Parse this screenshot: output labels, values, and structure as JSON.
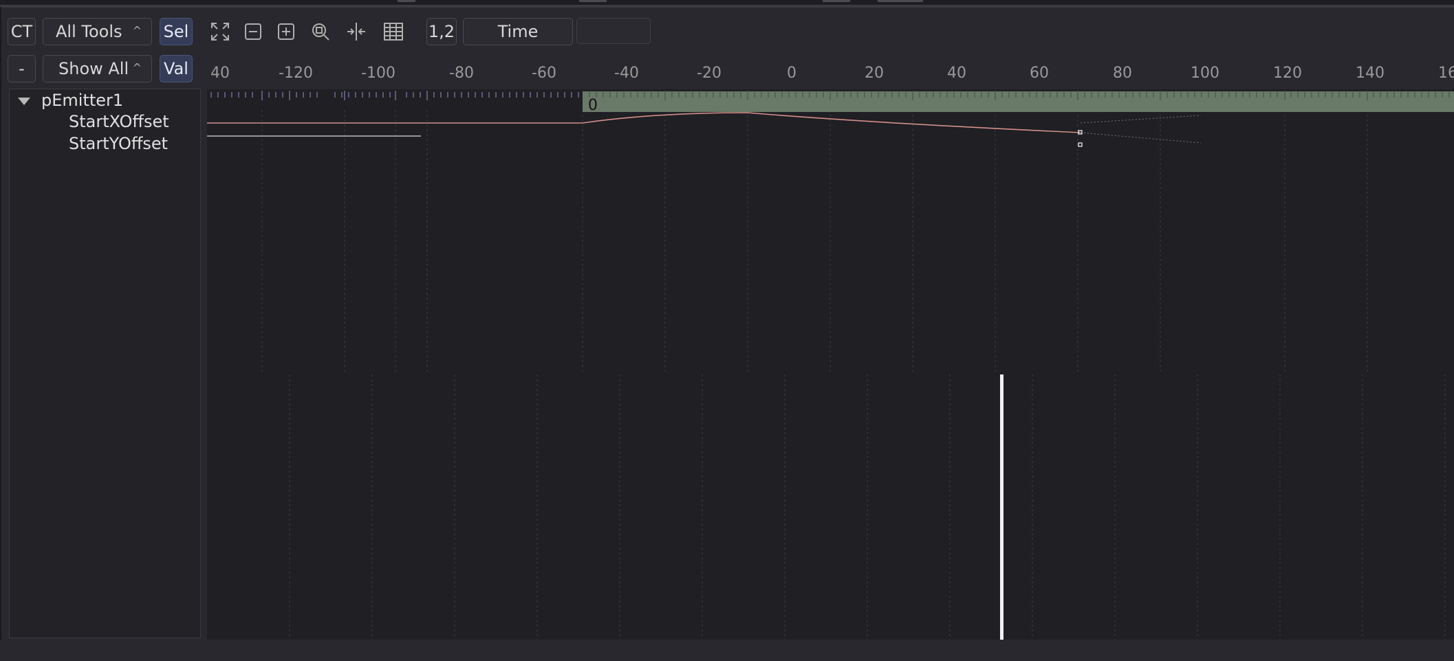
{
  "toolbar": {
    "ct_label": "CT",
    "tools_dropdown": "All Tools",
    "sel_label": "Sel",
    "minus_label": "-",
    "show_dropdown": "Show All",
    "val_label": "Val",
    "onetwo_label": "1,2",
    "time_label": "Time",
    "time_value": "",
    "caret": "^",
    "icons": [
      "fit-icon",
      "zoom-out-icon",
      "zoom-in-icon",
      "zoom-rect-icon",
      "time-stretch-icon",
      "spreadsheet-icon"
    ]
  },
  "tree": {
    "root": "pEmitter1",
    "children": [
      "StartXOffset",
      "StartYOffset"
    ]
  },
  "ruler": {
    "labels": [
      "40",
      "-120",
      "-100",
      "-80",
      "-60",
      "-40",
      "-20",
      "0",
      "20",
      "40",
      "60",
      "80",
      "100",
      "120",
      "140",
      "16"
    ]
  },
  "timeline": {
    "render_range_start_label": "0"
  },
  "colors": {
    "background": "#1f1f24",
    "range_bar": "#6a7a68",
    "curve_x": "#d4908a",
    "curve_y": "#bdbdbd",
    "playhead": "#f0f0f0",
    "active_button": "#343c58"
  }
}
